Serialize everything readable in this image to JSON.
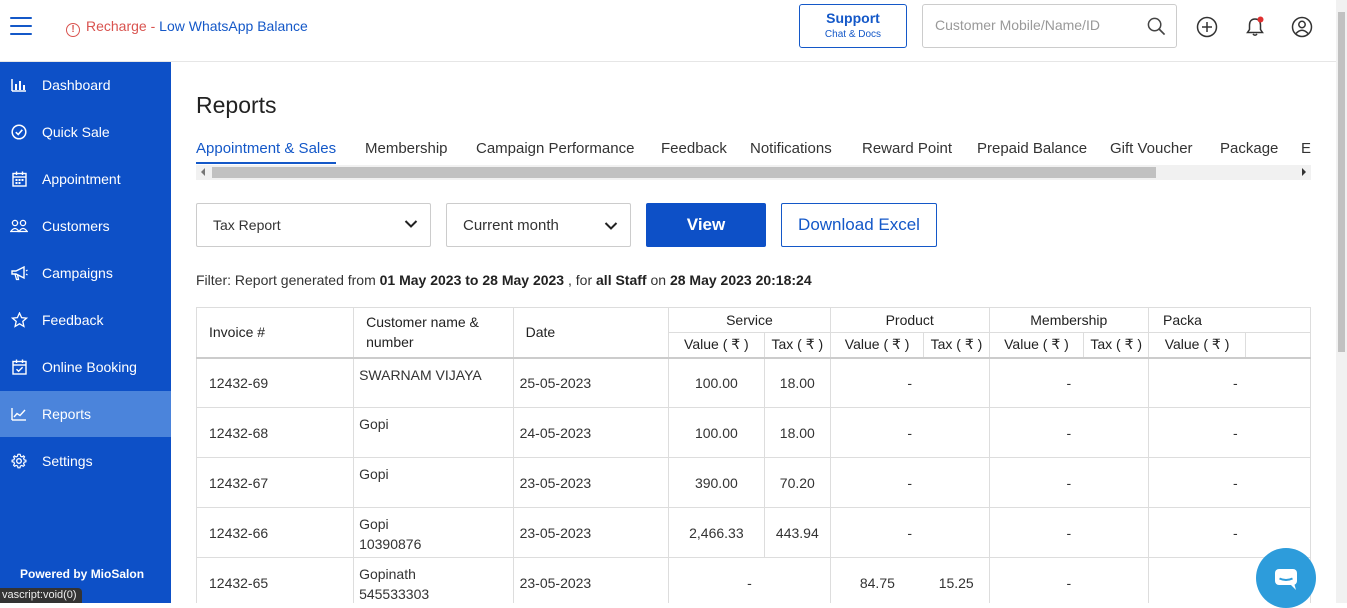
{
  "topbar": {
    "alert_text": "Recharge",
    "alert_sep": " - ",
    "alert_link": "Low WhatsApp Balance",
    "support_title": "Support",
    "support_sub": "Chat & Docs",
    "search_placeholder": "Customer Mobile/Name/ID"
  },
  "sidebar": {
    "items": [
      {
        "label": "Dashboard",
        "icon": "bar-chart-icon"
      },
      {
        "label": "Quick Sale",
        "icon": "check-circle-icon"
      },
      {
        "label": "Appointment",
        "icon": "calendar-icon"
      },
      {
        "label": "Customers",
        "icon": "users-icon"
      },
      {
        "label": "Campaigns",
        "icon": "megaphone-icon"
      },
      {
        "label": "Feedback",
        "icon": "star-icon"
      },
      {
        "label": "Online Booking",
        "icon": "calendar-check-icon"
      },
      {
        "label": "Reports",
        "icon": "line-chart-icon",
        "active": true
      },
      {
        "label": "Settings",
        "icon": "gear-icon"
      }
    ],
    "powered_by": "Powered by MioSalon",
    "status_tip": "vascript:void(0)"
  },
  "page": {
    "title": "Reports",
    "tabs": [
      "Appointment & Sales",
      "Membership",
      "Campaign Performance",
      "Feedback",
      "Notifications",
      "Reward Point",
      "Prepaid Balance",
      "Gift Voucher",
      "Package",
      "Ex"
    ],
    "active_tab": "Appointment & Sales",
    "report_select": "Tax Report",
    "period_select": "Current month",
    "view_button": "View",
    "excel_button": "Download Excel",
    "filter": {
      "prefix": "Filter: Report generated from ",
      "range": "01 May 2023 to 28 May 2023",
      "mid": " , for ",
      "staff": "all Staff",
      "on": " on ",
      "generated": "28 May 2023 20:18:24"
    }
  },
  "table": {
    "headers": {
      "invoice": "Invoice #",
      "customer": "Customer name & number",
      "date": "Date",
      "service": "Service",
      "product": "Product",
      "membership": "Membership",
      "package": "Packa",
      "value": "Value ( ₹ )",
      "tax": "Tax ( ₹ )"
    },
    "rows": [
      {
        "invoice": "12432-69",
        "name": "SWARNAM VIJAYA",
        "number": "",
        "date": "25-05-2023",
        "svc_value": "100.00",
        "svc_tax": "18.00",
        "prod": "-",
        "mem": "-",
        "pkg": "-"
      },
      {
        "invoice": "12432-68",
        "name": "Gopi",
        "number": "",
        "date": "24-05-2023",
        "svc_value": "100.00",
        "svc_tax": "18.00",
        "prod": "-",
        "mem": "-",
        "pkg": "-"
      },
      {
        "invoice": "12432-67",
        "name": "Gopi",
        "number": "",
        "date": "23-05-2023",
        "svc_value": "390.00",
        "svc_tax": "70.20",
        "prod": "-",
        "mem": "-",
        "pkg": "-"
      },
      {
        "invoice": "12432-66",
        "name": "Gopi",
        "number": "10390876",
        "date": "23-05-2023",
        "svc_value": "2,466.33",
        "svc_tax": "443.94",
        "prod": "-",
        "mem": "-",
        "pkg": "-"
      },
      {
        "invoice": "12432-65",
        "name": "Gopinath",
        "number": "545533303",
        "date": "23-05-2023",
        "svc": "-",
        "prod_value": "84.75",
        "prod_tax": "15.25",
        "mem": "-",
        "pkg": ""
      }
    ]
  },
  "colors": {
    "brand_blue": "#0d50c7",
    "sidebar_active": "#4b84db",
    "alert_red": "#d9534f",
    "chat_blue": "#2d9cdb"
  }
}
